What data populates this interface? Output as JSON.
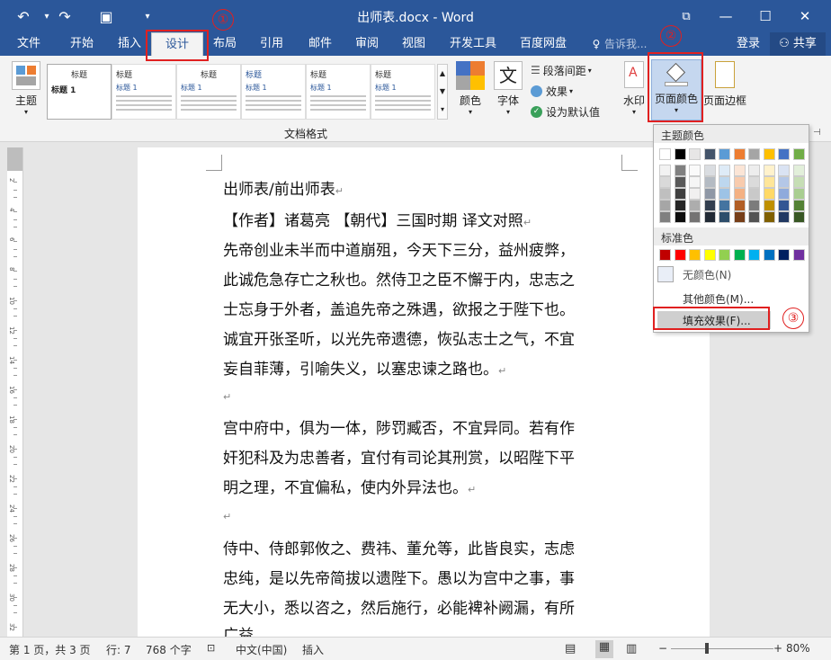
{
  "title_bar": {
    "doc_title": "出师表.docx - Word",
    "undo_icon": "↶",
    "redo_icon": "↷",
    "save_icon": "▣",
    "customize_icon": "▾",
    "restore_icon": "⧉",
    "minimize_icon": "—",
    "maximize_icon": "☐",
    "close_icon": "✕"
  },
  "tabs": [
    {
      "label": "文件"
    },
    {
      "label": "开始"
    },
    {
      "label": "插入"
    },
    {
      "label": "设计"
    },
    {
      "label": "布局"
    },
    {
      "label": "引用"
    },
    {
      "label": "邮件"
    },
    {
      "label": "审阅"
    },
    {
      "label": "视图"
    },
    {
      "label": "开发工具"
    },
    {
      "label": "百度网盘"
    }
  ],
  "tell_me": "告诉我...",
  "login": "登录",
  "share": "共享",
  "ribbon": {
    "theme_label": "主题",
    "style_thumbs": [
      {
        "title": "标题",
        "heading": "标题 1"
      },
      {
        "title": "标题",
        "heading": "标题 1"
      },
      {
        "title": "标题",
        "heading": "标题 1"
      },
      {
        "title": "标题",
        "heading": "标题 1"
      },
      {
        "title": "标题",
        "heading": "标题 1"
      },
      {
        "title": "标题",
        "heading": "标题 1"
      }
    ],
    "group_label": "文档格式",
    "colors_label": "颜色",
    "fonts_label": "字体",
    "paragraph_spacing": "段落间距",
    "effects": "效果",
    "set_default": "设为默认值",
    "watermark": "水印",
    "page_color": "页面颜色",
    "page_borders": "页面边框"
  },
  "dropdown": {
    "theme_colors_header": "主题颜色",
    "standard_colors_header": "标准色",
    "no_color": "无颜色(N)",
    "more_colors": "其他颜色(M)...",
    "fill_effects": "填充效果(F)...",
    "theme_top_row": [
      "#ffffff",
      "#000000",
      "#e7e6e6",
      "#44546a",
      "#5b9bd5",
      "#ed7d31",
      "#a5a5a5",
      "#ffc000",
      "#4472c4",
      "#70ad47"
    ],
    "standard_colors": [
      "#c00000",
      "#ff0000",
      "#ffc000",
      "#ffff00",
      "#92d050",
      "#00b050",
      "#00b0f0",
      "#0070c0",
      "#002060",
      "#7030a0"
    ]
  },
  "document": {
    "lines": [
      "出师表/前出师表",
      "【作者】诸葛亮 【朝代】三国时期 译文对照",
      "先帝创业未半而中道崩殂，今天下三分，益州疲弊，",
      "此诚危急存亡之秋也。然侍卫之臣不懈于内，忠志之",
      "士忘身于外者，盖追先帝之殊遇，欲报之于陛下也。",
      "诚宜开张圣听，以光先帝遗德，恢弘志士之气，不宜",
      "妄自菲薄，引喻失义，以塞忠谏之路也。",
      "",
      "宫中府中，俱为一体，陟罚臧否，不宜异同。若有作",
      "奸犯科及为忠善者，宜付有司论其刑赏，以昭陛下平",
      "明之理，不宜偏私，使内外异法也。",
      "",
      "侍中、侍郎郭攸之、费祎、董允等，此皆良实，志虑",
      "忠纯，是以先帝简拔以遗陛下。愚以为宫中之事，事",
      "无大小，悉以咨之，然后施行，必能裨补阙漏，有所",
      "广益。"
    ],
    "para_mark": "↵"
  },
  "annotations": [
    "①",
    "②",
    "③"
  ],
  "status_bar": {
    "page_info": "第 1 页，共 3 页",
    "line_info": "行: 7",
    "word_count": "768 个字",
    "language": "中文(中国)",
    "insert_mode": "插入",
    "zoom_minus": "−",
    "zoom_plus": "+",
    "zoom": "80%"
  },
  "ruler": {
    "numbers": [
      "2",
      "4",
      "6",
      "8",
      "10",
      "12",
      "14",
      "16",
      "18",
      "20",
      "22",
      "24",
      "26",
      "28",
      "30",
      "32"
    ]
  }
}
